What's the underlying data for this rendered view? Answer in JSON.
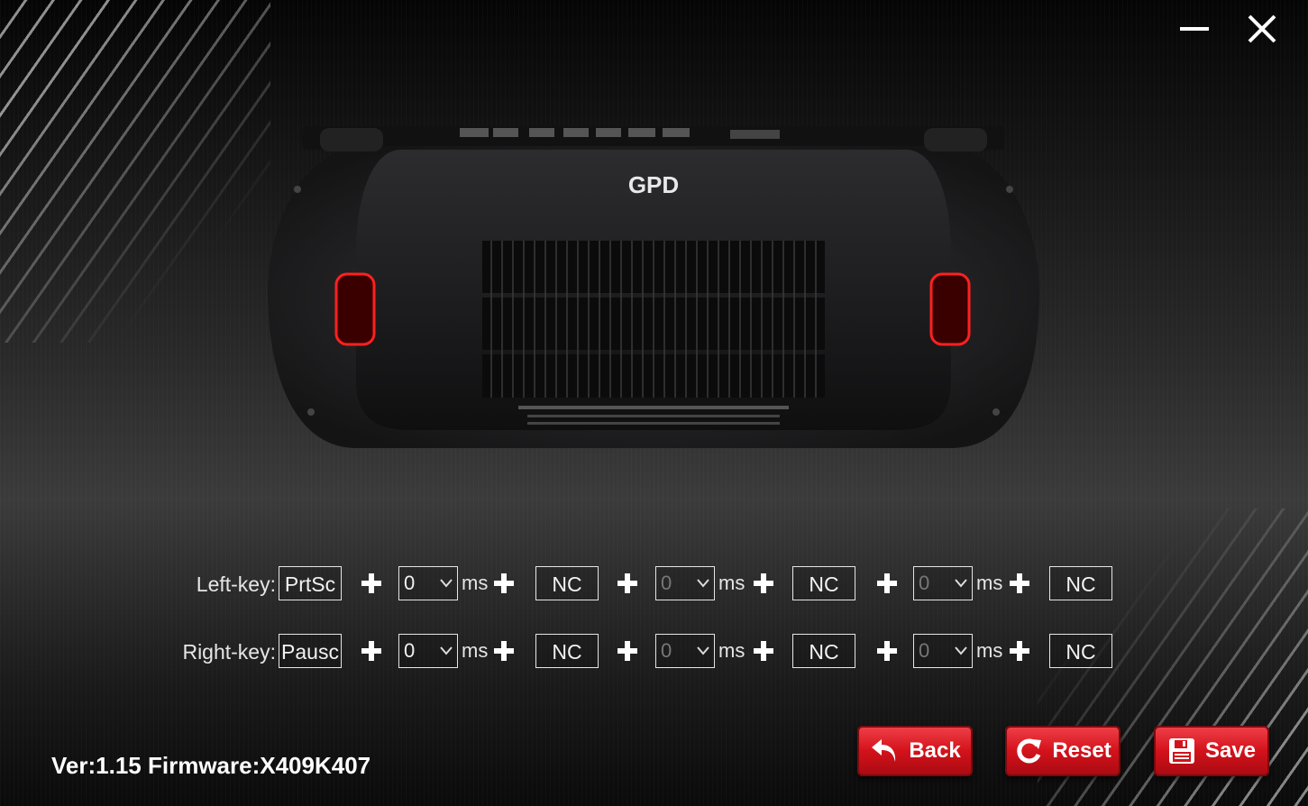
{
  "window": {
    "minimize_icon": "minimize-icon",
    "close_icon": "close-icon"
  },
  "device": {
    "brand_logo": "GPD"
  },
  "mapping": {
    "left": {
      "label": "Left-key:",
      "key1": "PrtSc",
      "delay1": "0",
      "key2": "NC",
      "delay2": "0",
      "key3": "NC",
      "delay3": "0",
      "key4": "NC"
    },
    "right": {
      "label": "Right-key:",
      "key1": "Pausc",
      "delay1": "0",
      "key2": "NC",
      "delay2": "0",
      "key3": "NC",
      "delay3": "0",
      "key4": "NC"
    },
    "unit": "ms"
  },
  "footer": {
    "version": "Ver:1.15 Firmware:X409K407"
  },
  "actions": {
    "back_label": "Back",
    "reset_label": "Reset",
    "save_label": "Save"
  },
  "colors": {
    "accent": "#d3121b",
    "background": "#1a1a1a"
  }
}
